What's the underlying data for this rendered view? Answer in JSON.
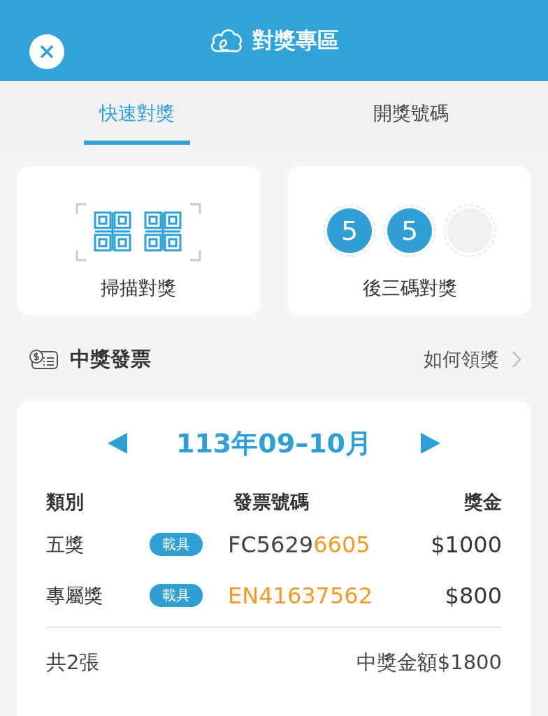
{
  "header": {
    "title": "對獎專區"
  },
  "tabs": [
    {
      "label": "快速對獎",
      "selected": true
    },
    {
      "label": "開獎號碼",
      "selected": false
    }
  ],
  "quick_actions": [
    {
      "kind": "scan",
      "label": "掃描對獎"
    },
    {
      "kind": "digits",
      "label": "後三碼對獎",
      "digits": [
        {
          "value": "5",
          "filled": true
        },
        {
          "value": "5",
          "filled": true
        },
        {
          "filled": false
        }
      ]
    }
  ],
  "section": {
    "title": "中獎發票",
    "link": "如何領獎"
  },
  "results": {
    "period": "113年09–10月",
    "columns": [
      "類別",
      "發票號碼",
      "獎金"
    ],
    "rows": [
      {
        "category": "五獎",
        "tag": "載具",
        "number_parts": [
          {
            "text": "FC5629",
            "highlight": false
          },
          {
            "text": "6605",
            "highlight": true
          }
        ],
        "amount": "$1000"
      },
      {
        "category": "專屬獎",
        "tag": "載具",
        "number_parts": [
          {
            "text": "EN41637562",
            "highlight": true
          }
        ],
        "amount": "$800"
      }
    ],
    "count": "共2張",
    "total": "中獎金額$1800"
  }
}
